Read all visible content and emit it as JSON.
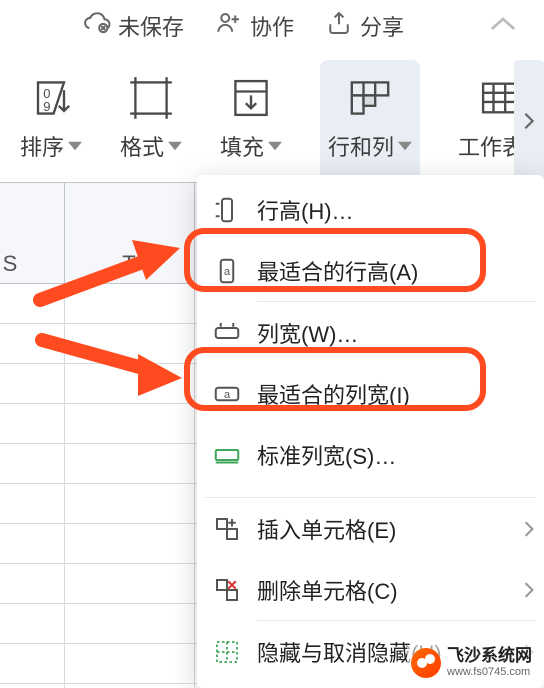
{
  "topbar": {
    "unsaved": "未保存",
    "collab": "协作",
    "share": "分享"
  },
  "ribbon": {
    "sort": "排序",
    "format": "格式",
    "fill": "填充",
    "rowcol": "行和列",
    "sheet": "工作表"
  },
  "sheet_headers": {
    "S": "S",
    "T": "T"
  },
  "menu": {
    "row_height": "行高(H)…",
    "autofit_row": "最适合的行高(A)",
    "col_width": "列宽(W)…",
    "autofit_col": "最适合的列宽(I)",
    "std_col_width": "标准列宽(S)…",
    "insert_cells": "插入单元格(E)",
    "delete_cells": "删除单元格(C)",
    "hide_unhide": "隐藏与取消隐藏(U)"
  },
  "watermark": {
    "name": "飞沙系统网",
    "url": "www.fs0745.com"
  }
}
